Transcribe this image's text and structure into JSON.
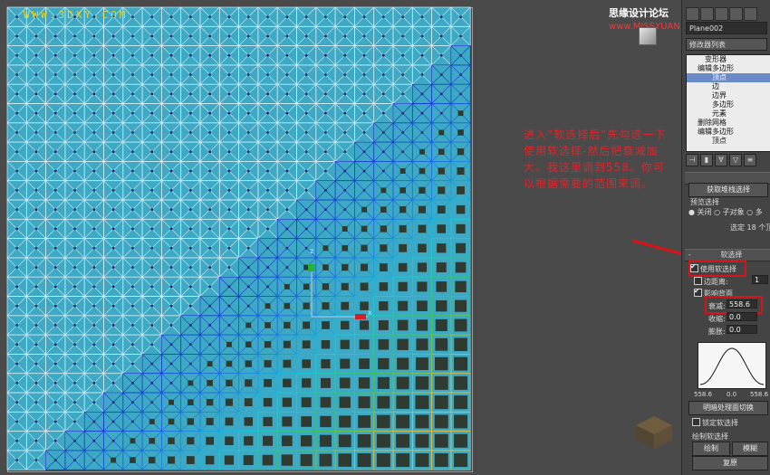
{
  "viewport": {
    "watermark_left": "WWW.3DXY.COM",
    "watermark_right_cn": "思缘设计论坛",
    "watermark_right_url": "www.MISSYUAN.COM",
    "annotation": "进入“软选择后”先勾选一下使用软选择-然后把衰减加大。我这里调到558。你可以根据需要的范围来调。",
    "colors": {
      "mesh": "#3ea9c4",
      "soft_hot": "#f0c23a",
      "annotation": "#e4242a",
      "highlight": "#d8141b"
    }
  },
  "panel": {
    "object_name": "Plane002",
    "modifier_list": "修改器列表",
    "stack": [
      {
        "label": "变形器",
        "indent": 2,
        "selected": false
      },
      {
        "label": "编辑多边形",
        "indent": 1,
        "selected": false
      },
      {
        "label": "顶点",
        "indent": 3,
        "selected": true
      },
      {
        "label": "边",
        "indent": 3,
        "selected": false
      },
      {
        "label": "边界",
        "indent": 3,
        "selected": false
      },
      {
        "label": "多边形",
        "indent": 3,
        "selected": false
      },
      {
        "label": "元素",
        "indent": 3,
        "selected": false
      },
      {
        "label": "删除网格",
        "indent": 1,
        "selected": false
      },
      {
        "label": "编辑多边形",
        "indent": 1,
        "selected": false
      },
      {
        "label": "顶点",
        "indent": 3,
        "selected": false
      }
    ],
    "get_stack_selection": "获取堆栈选择",
    "preview_selection": "预览选择",
    "preview_off": "关闭",
    "preview_subobj": "子对象",
    "preview_multi": "多",
    "selected_count": "选定 18 个顶",
    "soft_selection_title": "软选择",
    "use_soft_selection": "使用软选择",
    "edge_distance": "边距离:",
    "edge_distance_value": "1",
    "affect_backfacing": "影响背面",
    "falloff_label": "衰减:",
    "falloff_value": "558.6",
    "pinch_label": "收缩:",
    "pinch_value": "0.0",
    "bubble_label": "膨胀:",
    "bubble_value": "0.0",
    "curve_left": "558.6",
    "curve_mid": "0.0",
    "curve_right": "558.6",
    "shaded_face_toggle": "明暗处理面切换",
    "lock_soft_selection": "锁定软选择",
    "paint_soft_selection": "绘制软选择",
    "paint_button": "绘制",
    "blur_button": "模糊",
    "revert_button": "复原"
  }
}
